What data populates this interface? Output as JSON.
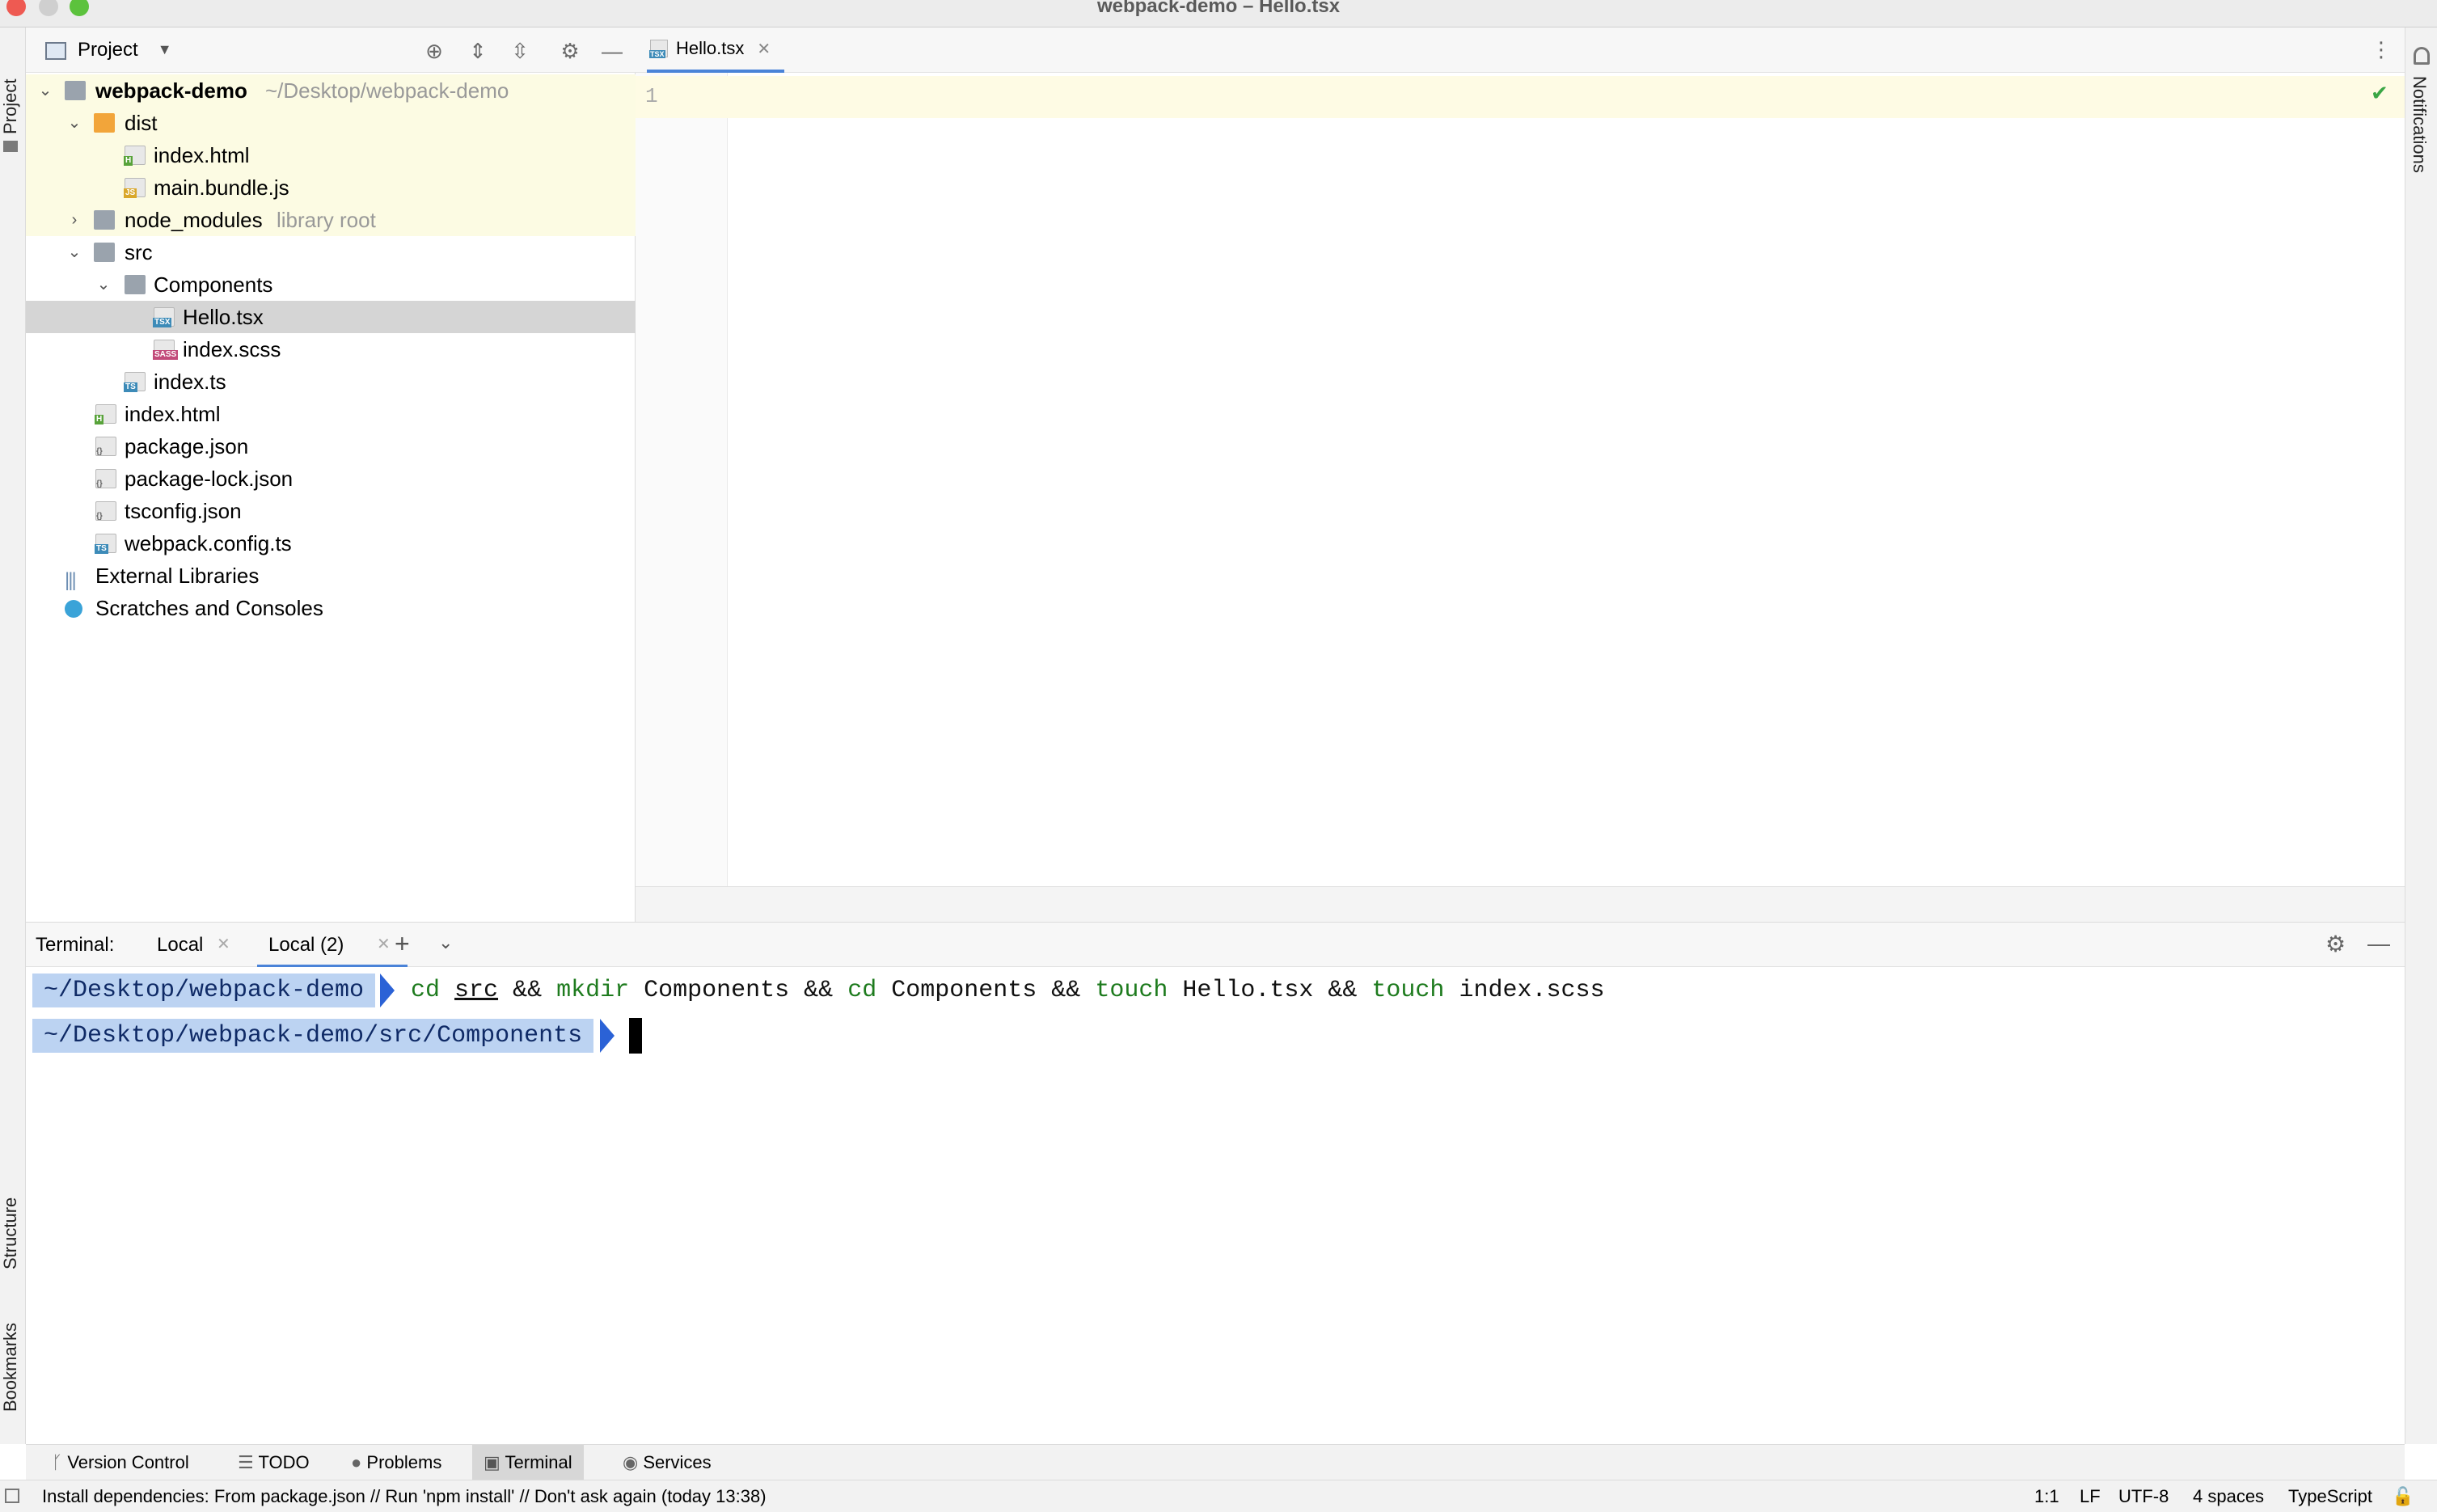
{
  "window": {
    "title": "webpack-demo – Hello.tsx"
  },
  "side_tabs": {
    "project": "Project",
    "structure": "Structure",
    "bookmarks": "Bookmarks",
    "notifications": "Notifications"
  },
  "project_panel": {
    "title": "Project",
    "tree": [
      {
        "label": "webpack-demo",
        "suffix": "~/Desktop/webpack-demo",
        "icon": "folder-icon"
      },
      {
        "label": "dist",
        "icon": "folder-icon"
      },
      {
        "label": "index.html",
        "icon": "html-file-icon"
      },
      {
        "label": "main.bundle.js",
        "icon": "js-file-icon"
      },
      {
        "label": "node_modules",
        "suffix": "library root",
        "icon": "folder-icon"
      },
      {
        "label": "src",
        "icon": "folder-icon"
      },
      {
        "label": "Components",
        "icon": "folder-icon"
      },
      {
        "label": "Hello.tsx",
        "icon": "tsx-file-icon"
      },
      {
        "label": "index.scss",
        "icon": "sass-file-icon"
      },
      {
        "label": "index.ts",
        "icon": "ts-file-icon"
      },
      {
        "label": "index.html",
        "icon": "html-file-icon"
      },
      {
        "label": "package.json",
        "icon": "json-file-icon"
      },
      {
        "label": "package-lock.json",
        "icon": "json-file-icon"
      },
      {
        "label": "tsconfig.json",
        "icon": "json-file-icon"
      },
      {
        "label": "webpack.config.ts",
        "icon": "ts-file-icon"
      },
      {
        "label": "External Libraries",
        "icon": "library-icon"
      },
      {
        "label": "Scratches and Consoles",
        "icon": "scratches-icon"
      }
    ]
  },
  "editor": {
    "tab_label": "Hello.tsx",
    "line_number": "1"
  },
  "terminal": {
    "label": "Terminal:",
    "tabs": [
      "Local",
      "Local (2)"
    ],
    "lines": [
      {
        "prompt": "~/Desktop/webpack-demo",
        "tokens": [
          "cd",
          "src",
          "&&",
          "mkdir",
          "Components",
          "&&",
          "cd",
          "Components",
          "&&",
          "touch",
          "Hello.tsx",
          "&&",
          "touch",
          "index.scss"
        ]
      },
      {
        "prompt": "~/Desktop/webpack-demo/src/Components"
      }
    ]
  },
  "tool_windows": [
    "Version Control",
    "TODO",
    "Problems",
    "Terminal",
    "Services"
  ],
  "status_bar": {
    "message": "Install dependencies: From package.json // Run 'npm install' // Don't ask again (today 13:38)",
    "position": "1:1",
    "line_sep": "LF",
    "encoding": "UTF-8",
    "indent": "4 spaces",
    "language": "TypeScript"
  },
  "colors": {
    "accent": "#4a83d8",
    "prompt_bg": "#bcd3f2",
    "command_keyword": "#1e7b1e",
    "highlight": "#fcfbe3"
  }
}
